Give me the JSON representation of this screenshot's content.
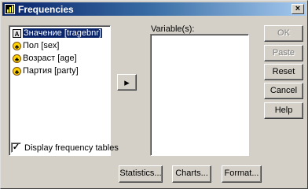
{
  "window": {
    "title": "Frequencies",
    "close_glyph": "×"
  },
  "variables": {
    "items": [
      {
        "label": "Значение [tragebnr]",
        "icon": "scale-variable-icon",
        "glyph": "A"
      },
      {
        "label": "Пол [sex]",
        "icon": "nominal-variable-icon",
        "glyph": "♣"
      },
      {
        "label": "Возраст [age]",
        "icon": "nominal-variable-icon",
        "glyph": "♣"
      },
      {
        "label": "Партия [party]",
        "icon": "nominal-variable-icon",
        "glyph": "♣"
      }
    ]
  },
  "target": {
    "label": "Variable(s):"
  },
  "move_button": {
    "glyph": "▸"
  },
  "buttons": {
    "ok": "OK",
    "paste": "Paste",
    "reset": "Reset",
    "cancel": "Cancel",
    "help": "Help"
  },
  "display_tables": {
    "label": "Display frequency tables",
    "checked": true,
    "check_glyph": "✓"
  },
  "bottom_buttons": {
    "statistics": "Statistics...",
    "charts": "Charts...",
    "format": "Format..."
  }
}
